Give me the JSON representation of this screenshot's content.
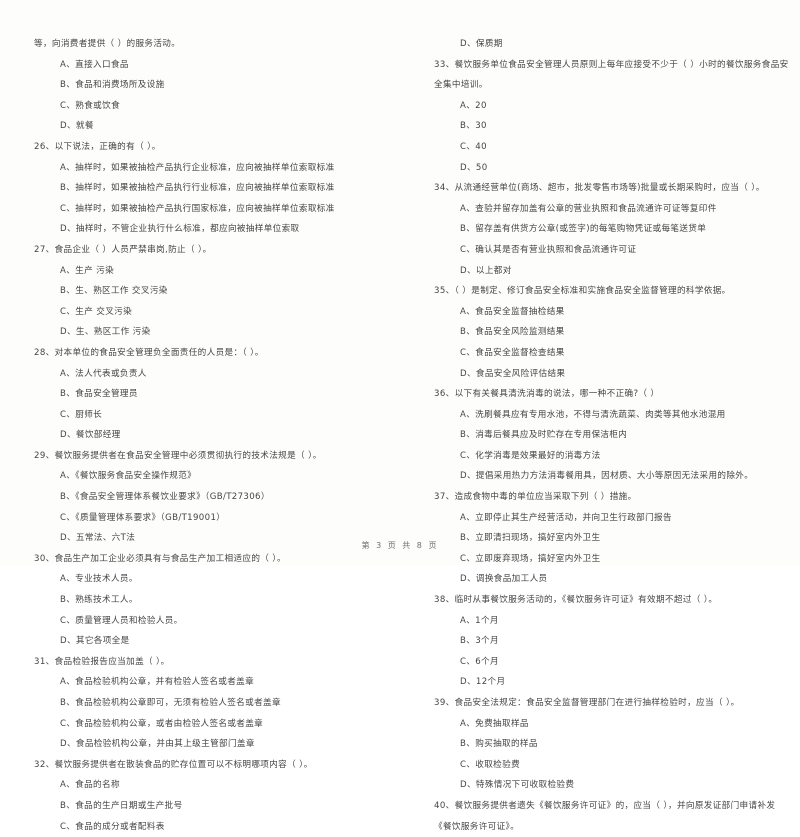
{
  "document": {
    "footer": "第 3 页 共 8 页",
    "page_number": "3",
    "total_pages": "8",
    "text_color": "#3d3d3d",
    "background_color": "#ffffff"
  },
  "left_column": [
    {
      "type": "continuation",
      "text": "等，向消费者提供（    ）的服务活动。"
    },
    {
      "type": "option",
      "text": "A、直接入口食品"
    },
    {
      "type": "option",
      "text": "B、食品和消费场所及设施"
    },
    {
      "type": "option",
      "text": "C、熟食或饮食"
    },
    {
      "type": "option",
      "text": "D、就餐"
    },
    {
      "type": "stem",
      "text": "26、以下说法，正确的有（     ）。"
    },
    {
      "type": "option",
      "text": "A、抽样时，如果被抽检产品执行企业标准，应向被抽样单位索取标准"
    },
    {
      "type": "option",
      "text": "B、抽样时，如果被抽检产品执行行业标准，应向被抽样单位索取标准"
    },
    {
      "type": "option",
      "text": "C、抽样时，如果被抽检产品执行国家标准，应向被抽样单位索取标准"
    },
    {
      "type": "option",
      "text": "D、抽样时，不管企业执行什么标准，都应向被抽样单位索取"
    },
    {
      "type": "stem",
      "text": "27、食品企业（     ）人员严禁串岗,防止（      ）。"
    },
    {
      "type": "option",
      "text": "A、生产  污染"
    },
    {
      "type": "option",
      "text": "B、生、熟区工作  交叉污染"
    },
    {
      "type": "option",
      "text": "C、生产  交叉污染"
    },
    {
      "type": "option",
      "text": "D、生、熟区工作  污染"
    },
    {
      "type": "stem",
      "text": "28、对本单位的食品安全管理负全面责任的人员是：（      ）。"
    },
    {
      "type": "option",
      "text": "A、法人代表或负责人"
    },
    {
      "type": "option",
      "text": "B、食品安全管理员"
    },
    {
      "type": "option",
      "text": "C、厨师长"
    },
    {
      "type": "option",
      "text": "D、餐饮部经理"
    },
    {
      "type": "stem",
      "text": "29、餐饮服务提供者在食品安全管理中必须贯彻执行的技术法规是（     ）。"
    },
    {
      "type": "option",
      "text": "A、《餐饮服务食品安全操作规范》"
    },
    {
      "type": "option",
      "text": "B、《食品安全管理体系餐饮业要求》（GB/T27306）"
    },
    {
      "type": "option",
      "text": "C、《质量管理体系要求》（GB/T19001）"
    },
    {
      "type": "option",
      "text": "D、五常法、六T法"
    },
    {
      "type": "stem",
      "text": "30、食品生产加工企业必须具有与食品生产加工相适应的（     ）。"
    },
    {
      "type": "option",
      "text": "A、专业技术人员。"
    },
    {
      "type": "option",
      "text": "B、熟练技术工人。"
    },
    {
      "type": "option",
      "text": "C、质量管理人员和检验人员。"
    },
    {
      "type": "option",
      "text": "D、其它各项全是"
    },
    {
      "type": "stem",
      "text": "31、食品检验报告应当加盖（     ）。"
    },
    {
      "type": "option",
      "text": "A、食品检验机构公章，并有检验人签名或者盖章"
    },
    {
      "type": "option",
      "text": "B、食品检验机构公章即可，无须有检验人签名或者盖章"
    },
    {
      "type": "option",
      "text": "C、食品检验机构公章，或者由检验人签名或者盖章"
    },
    {
      "type": "option",
      "text": "D、食品检验机构公章，并由其上级主管部门盖章"
    },
    {
      "type": "stem",
      "text": "32、餐饮服务提供者在散装食品的贮存位置可以不标明哪项内容（      ）。"
    },
    {
      "type": "option",
      "text": "A、食品的名称"
    },
    {
      "type": "option",
      "text": "B、食品的生产日期或生产批号"
    },
    {
      "type": "option",
      "text": "C、食品的成分或者配料表"
    }
  ],
  "right_column": [
    {
      "type": "option",
      "text": "D、保质期"
    },
    {
      "type": "stem",
      "text": "33、餐饮服务单位食品安全管理人员原则上每年应接受不少于（     ）小时的餐饮服务食品安"
    },
    {
      "type": "continuation",
      "text": "全集中培训。"
    },
    {
      "type": "option",
      "text": "A、20"
    },
    {
      "type": "option",
      "text": "B、30"
    },
    {
      "type": "option",
      "text": "C、40"
    },
    {
      "type": "option",
      "text": "D、50"
    },
    {
      "type": "stem",
      "text": "34、从流通经营单位(商场、超市，批发零售市场等)批量或长期采购时，应当（     ）。"
    },
    {
      "type": "option",
      "text": "A、查验并留存加盖有公章的营业执照和食品流通许可证等复印件"
    },
    {
      "type": "option",
      "text": "B、留存盖有供货方公章(或签字)的每笔购物凭证或每笔送货单"
    },
    {
      "type": "option",
      "text": "C、确认其是否有营业执照和食品流通许可证"
    },
    {
      "type": "option",
      "text": "D、以上都对"
    },
    {
      "type": "stem",
      "text": "35、（     ）是制定、修订食品安全标准和实施食品安全监督管理的科学依据。"
    },
    {
      "type": "option",
      "text": "A、食品安全监督抽检结果"
    },
    {
      "type": "option",
      "text": "B、食品安全风险监测结果"
    },
    {
      "type": "option",
      "text": "C、食品安全监督检查结果"
    },
    {
      "type": "option",
      "text": "D、食品安全风险评估结果"
    },
    {
      "type": "stem",
      "text": "36、以下有关餐具清洗消毒的说法，哪一种不正确?（     ）"
    },
    {
      "type": "option",
      "text": "A、洗刷餐具应有专用水池，不得与清洗蔬菜、肉类等其他水池混用"
    },
    {
      "type": "option",
      "text": "B、消毒后餐具应及时贮存在专用保洁柜内"
    },
    {
      "type": "option",
      "text": "C、化学消毒是效果最好的消毒方法"
    },
    {
      "type": "option",
      "text": "D、提倡采用热力方法消毒餐用具，因材质、大小等原因无法采用的除外。"
    },
    {
      "type": "stem",
      "text": "37、造成食物中毒的单位应当采取下列（     ）措施。"
    },
    {
      "type": "option",
      "text": "A、立即停止其生产经营活动，并向卫生行政部门报告"
    },
    {
      "type": "option",
      "text": "B、立即清扫现场，搞好室内外卫生"
    },
    {
      "type": "option",
      "text": "C、立即废弃现场，搞好室内外卫生"
    },
    {
      "type": "option",
      "text": "D、调换食品加工人员"
    },
    {
      "type": "stem",
      "text": "38、临时从事餐饮服务活动的，《餐饮服务许可证》有效期不超过（     ）。"
    },
    {
      "type": "option",
      "text": "A、1个月"
    },
    {
      "type": "option",
      "text": "B、3个月"
    },
    {
      "type": "option",
      "text": "C、6个月"
    },
    {
      "type": "option",
      "text": "D、12个月"
    },
    {
      "type": "stem",
      "text": "39、食品安全法规定：食品安全监督管理部门在进行抽样检验时，应当（     ）。"
    },
    {
      "type": "option",
      "text": "A、免费抽取样品"
    },
    {
      "type": "option",
      "text": "B、购买抽取的样品"
    },
    {
      "type": "option",
      "text": "C、收取检验费"
    },
    {
      "type": "option",
      "text": "D、特殊情况下可收取检验费"
    },
    {
      "type": "stem",
      "text": "40、餐饮服务提供者遗失《餐饮服务许可证》的，应当（        ），并向原发证部门申请补发"
    },
    {
      "type": "continuation",
      "text": "《餐饮服务许可证》。"
    }
  ]
}
